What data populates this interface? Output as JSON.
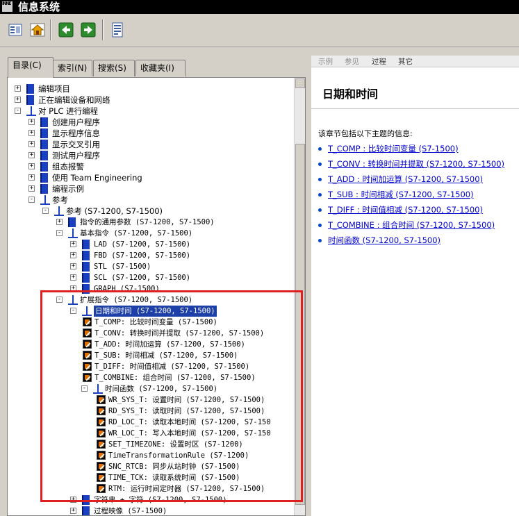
{
  "window": {
    "title": "信息系统",
    "app_icon_text": "INNE"
  },
  "toolbar": {
    "buttons": [
      {
        "icon": "contents-icon"
      },
      {
        "icon": "home-icon"
      },
      {
        "icon": "back-icon"
      },
      {
        "icon": "forward-icon"
      },
      {
        "icon": "print-icon"
      }
    ],
    "colors": {
      "nav_green": "#2e8b2e",
      "home": "#e8a000"
    }
  },
  "left_tabs": [
    {
      "label": "目录(C)",
      "active": true
    },
    {
      "label": "索引(N)",
      "active": false
    },
    {
      "label": "搜索(S)",
      "active": false
    },
    {
      "label": "收藏夹(I)",
      "active": false
    }
  ],
  "tree": [
    {
      "label": "编辑项目",
      "icon": "book"
    },
    {
      "label": "正在编辑设备和网络",
      "icon": "book"
    },
    {
      "label": "对 PLC 进行编程",
      "icon": "openbook"
    },
    {
      "label": "创建用户程序",
      "icon": "book"
    },
    {
      "label": "显示程序信息",
      "icon": "book"
    },
    {
      "label": "显示交叉引用",
      "icon": "book"
    },
    {
      "label": "测试用户程序",
      "icon": "book"
    },
    {
      "label": "组态报警",
      "icon": "book"
    },
    {
      "label": "使用 Team Engineering",
      "icon": "book"
    },
    {
      "label": "编程示例",
      "icon": "book"
    },
    {
      "label": "参考",
      "icon": "openbook"
    },
    {
      "label": "参考 (S7-1200, S7-1500)",
      "icon": "openbook"
    },
    {
      "label": "指令的通用参数 (S7-1200, S7-1500)",
      "icon": "book"
    },
    {
      "label": "基本指令 (S7-1200, S7-1500)",
      "icon": "openbook"
    },
    {
      "label": "LAD (S7-1200, S7-1500)",
      "icon": "book"
    },
    {
      "label": "FBD (S7-1200, S7-1500)",
      "icon": "book"
    },
    {
      "label": "STL (S7-1500)",
      "icon": "book"
    },
    {
      "label": "SCL (S7-1200, S7-1500)",
      "icon": "book"
    },
    {
      "label": "GRAPH (S7-1500)",
      "icon": "book"
    },
    {
      "label": "扩展指令 (S7-1200, S7-1500)",
      "icon": "openbook"
    },
    {
      "label": "日期和时间 (S7-1200, S7-1500)",
      "icon": "openbook"
    },
    {
      "label": "T_COMP: 比较时间变量 (S7-1500)",
      "icon": "topic"
    },
    {
      "label": "T_CONV: 转换时间并提取 (S7-1200, S7-1500)",
      "icon": "topic"
    },
    {
      "label": "T_ADD: 时间加运算 (S7-1200, S7-1500)",
      "icon": "topic"
    },
    {
      "label": "T_SUB: 时间相减 (S7-1200, S7-1500)",
      "icon": "topic"
    },
    {
      "label": "T_DIFF: 时间值相减 (S7-1200, S7-1500)",
      "icon": "topic"
    },
    {
      "label": "T_COMBINE: 组合时间 (S7-1200, S7-1500)",
      "icon": "topic"
    },
    {
      "label": "时间函数 (S7-1200, S7-1500)",
      "icon": "openbook"
    },
    {
      "label": "WR_SYS_T: 设置时间 (S7-1200, S7-1500)",
      "icon": "topic"
    },
    {
      "label": "RD_SYS_T: 读取时间 (S7-1200, S7-1500)",
      "icon": "topic"
    },
    {
      "label": "RD_LOC_T: 读取本地时间 (S7-1200, S7-150",
      "icon": "topic"
    },
    {
      "label": "WR_LOC_T: 写入本地时间 (S7-1200, S7-150",
      "icon": "topic"
    },
    {
      "label": "SET_TIMEZONE: 设置时区 (S7-1200)",
      "icon": "topic"
    },
    {
      "label": "TimeTransformationRule (S7-1200)",
      "icon": "topic"
    },
    {
      "label": "SNC_RTCB: 同步从站时钟 (S7-1500)",
      "icon": "topic"
    },
    {
      "label": "TIME_TCK: 读取系统时间 (S7-1500)",
      "icon": "topic"
    },
    {
      "label": "RTM: 运行时间定时器 (S7-1200, S7-1500)",
      "icon": "topic"
    },
    {
      "label": "字符串 + 字符 (S7-1200, S7-1500)",
      "icon": "book"
    },
    {
      "label": "过程映像 (S7-1500)",
      "icon": "book"
    }
  ],
  "right": {
    "tabs": [
      {
        "label": "示例",
        "enabled": false
      },
      {
        "label": "参见",
        "enabled": false
      },
      {
        "label": "过程",
        "enabled": true
      },
      {
        "label": "其它",
        "enabled": true
      }
    ],
    "title": "日期和时间",
    "intro": "该章节包括以下主题的信息:",
    "links": [
      "T_COMP : 比较时间变量 (S7-1500)",
      "T_CONV : 转换时间并提取 (S7-1200, S7-1500)",
      "T_ADD : 时间加运算 (S7-1200, S7-1500)",
      "T_SUB : 时间相减 (S7-1200, S7-1500)",
      "T_DIFF : 时间值相减 (S7-1200, S7-1500)",
      "T_COMBINE : 组合时间 (S7-1200, S7-1500)",
      "时间函数 (S7-1200, S7-1500)"
    ],
    "link_color": "#0000cc"
  },
  "highlight_color": "#e02020"
}
